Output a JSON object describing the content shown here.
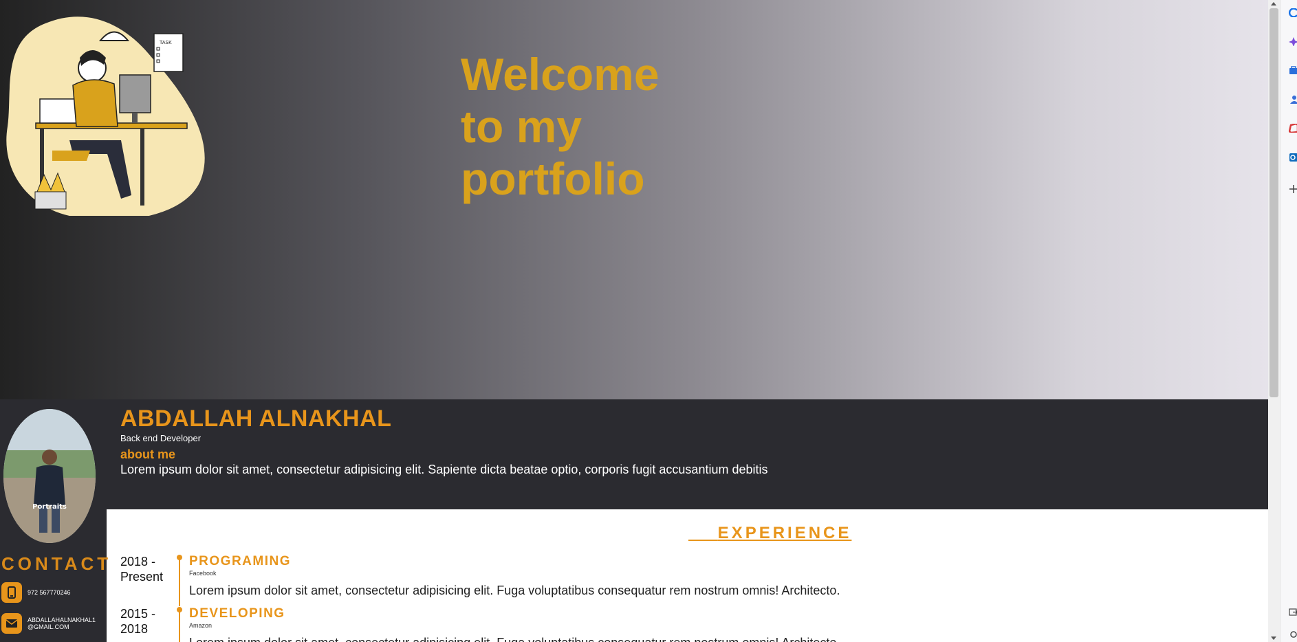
{
  "hero": {
    "title": "Welcome to my portfolio"
  },
  "profile": {
    "name": "ABDALLAH ALNAKHAL",
    "role": "Back end Developer",
    "about_title": "about me",
    "about_text": "Lorem ipsum dolor sit amet, consectetur adipisicing elit. Sapiente dicta beatae optio, corporis fugit accusantium debitis",
    "photo_caption": "Portraits"
  },
  "contact": {
    "title": "CONTACT",
    "items": [
      {
        "icon": "phone-icon",
        "text": "972 567770246"
      },
      {
        "icon": "mail-icon",
        "text": "ABDALLAHALNAKHAL1@GMAIL.COM"
      }
    ]
  },
  "experience": {
    "title": "EXPERIENCE",
    "items": [
      {
        "years": "2018 - Present",
        "role": "PROGRAMING",
        "company": "Facebook",
        "description": "Lorem ipsum dolor sit amet, consectetur adipisicing elit. Fuga voluptatibus consequatur rem nostrum omnis! Architecto."
      },
      {
        "years": "2015 - 2018",
        "role": "DEVELOPING",
        "company": "Amazon",
        "description": "Lorem ipsum dolor sit amet, consectetur adipisicing elit. Fuga voluptatibus consequatur rem nostrum omnis! Architecto."
      }
    ]
  },
  "colors": {
    "accent": "#e8951b",
    "title_gold": "#d9a21c",
    "band_dark": "#2b2b30"
  }
}
